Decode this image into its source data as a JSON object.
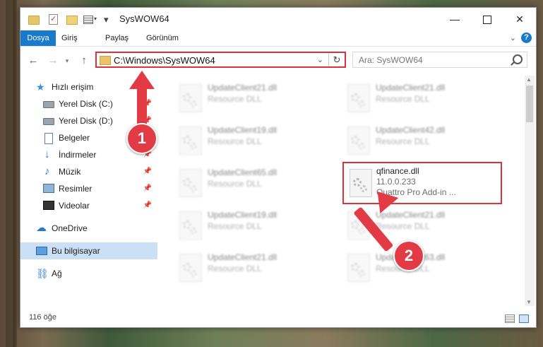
{
  "window": {
    "title": "SysWOW64",
    "controls": {
      "minimize": "—",
      "maximize": "",
      "close": "✕"
    }
  },
  "ribbon": {
    "tabs": [
      "Dosya",
      "Giriş",
      "Paylaş",
      "Görünüm"
    ],
    "help": "?"
  },
  "address": {
    "path": "C:\\Windows\\SysWOW64",
    "search_placeholder": "Ara: SysWOW64"
  },
  "nav_pane": {
    "items": [
      {
        "label": "Hızlı erişim",
        "icon": "star-icon",
        "pinned": false
      },
      {
        "label": "Yerel Disk (C:)",
        "icon": "drive-icon",
        "pinned": true
      },
      {
        "label": "Yerel Disk (D:)",
        "icon": "drive-icon",
        "pinned": true
      },
      {
        "label": "Belgeler",
        "icon": "documents-icon",
        "pinned": true
      },
      {
        "label": "İndirmeler",
        "icon": "downloads-icon",
        "pinned": true
      },
      {
        "label": "Müzik",
        "icon": "music-icon",
        "pinned": true
      },
      {
        "label": "Resimler",
        "icon": "pictures-icon",
        "pinned": true
      },
      {
        "label": "Videolar",
        "icon": "videos-icon",
        "pinned": true
      },
      {
        "label": "OneDrive",
        "icon": "onedrive-icon",
        "pinned": false
      },
      {
        "label": "Bu bilgisayar",
        "icon": "this-pc-icon",
        "pinned": false,
        "selected": true
      },
      {
        "label": "Ağ",
        "icon": "network-icon",
        "pinned": false
      }
    ]
  },
  "files": [
    {
      "name": "UpdateClient21.dll",
      "type": "Resource DLL"
    },
    {
      "name": "UpdateClient21.dll",
      "type": "Resource DLL"
    },
    {
      "name": "UpdateClient19.dll",
      "type": "Resource DLL"
    },
    {
      "name": "UpdateClient42.dll",
      "type": "Resource DLL"
    },
    {
      "name": "UpdateClient65.dll",
      "type": "Resource DLL"
    },
    {
      "name": "qfinance.dll",
      "version": "11.0.0.233",
      "description": "Quattro Pro Add-in ...",
      "highlighted": true
    },
    {
      "name": "UpdateClient19.dll",
      "type": "Resource DLL"
    },
    {
      "name": "UpdateClient21.dll",
      "type": "Resource DLL"
    },
    {
      "name": "UpdateClient21.dll",
      "type": "Resource DLL"
    },
    {
      "name": "UpdateClient63.dll",
      "type": "Resource DLL"
    }
  ],
  "status": {
    "item_count": "116 öğe"
  },
  "annotations": {
    "step1": "1",
    "step2": "2",
    "accent_color": "#e23b45"
  }
}
